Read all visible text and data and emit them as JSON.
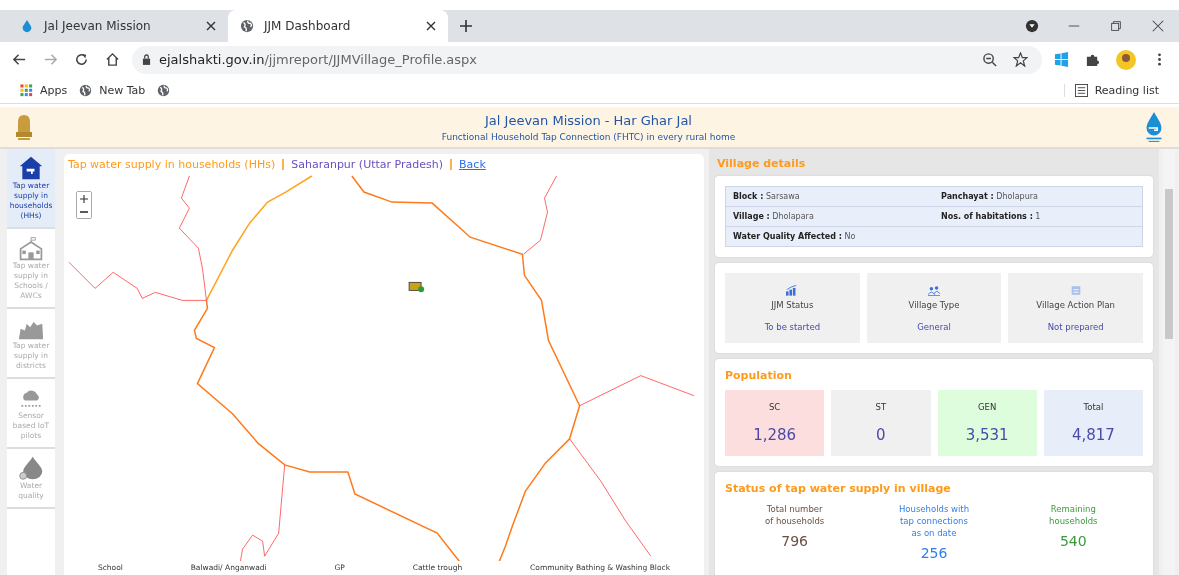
{
  "browser": {
    "tabs": [
      {
        "title": "Jal Jeevan Mission",
        "selected": false
      },
      {
        "title": "JJM Dashboard",
        "selected": true
      }
    ],
    "url_host": "ejalshakti.gov.in",
    "url_path": "/jjmreport/JJMVillage_Profile.aspx",
    "bookmarks": [
      {
        "label": "Apps"
      },
      {
        "label": "New Tab"
      }
    ],
    "reading_list": "Reading list"
  },
  "header": {
    "title": "Jal Jeevan Mission - Har Ghar Jal",
    "subtitle": "Functional Household Tap Connection (FHTC) in every rural home"
  },
  "sidebar": {
    "items": [
      {
        "label": "Tap water supply in households (HHs)",
        "selected": true
      },
      {
        "label": "Tap water supply in Schools / AWCs",
        "selected": false
      },
      {
        "label": "Tap water supply in districts",
        "selected": false
      },
      {
        "label": "Sensor based IoT pilots",
        "selected": false
      },
      {
        "label": "Water quality",
        "selected": false
      }
    ]
  },
  "map": {
    "title": "Tap water supply in households (HHs)",
    "location": "Saharanpur (Uttar Pradesh)",
    "back_link": "Back",
    "legend": [
      "School",
      "Balwadi/ Anganwadi",
      "GP",
      "Cattle trough",
      "Community Bathing & Washing Block"
    ]
  },
  "village_details": {
    "title": "Village details",
    "fields": [
      {
        "label": "Block :",
        "value": "Sarsawa"
      },
      {
        "label": "Panchayat :",
        "value": "Dholapura"
      },
      {
        "label": "Village :",
        "value": "Dholapara"
      },
      {
        "label": "Nos. of habitations :",
        "value": "1"
      },
      {
        "label": "Water Quality Affected :",
        "value": "No"
      }
    ],
    "tiles": [
      {
        "label": "JJM Status",
        "value": "To be started"
      },
      {
        "label": "Village Type",
        "value": "General"
      },
      {
        "label": "Village Action Plan",
        "value": "Not prepared"
      }
    ]
  },
  "population": {
    "title": "Population",
    "groups": [
      {
        "label": "SC",
        "value": "1,286",
        "color": "#fddede"
      },
      {
        "label": "ST",
        "value": "0",
        "color": "#f0f0f0"
      },
      {
        "label": "GEN",
        "value": "3,531",
        "color": "#ddfddc"
      },
      {
        "label": "Total",
        "value": "4,817",
        "color": "#e8eef9"
      }
    ]
  },
  "tap_status": {
    "title": "Status of tap water supply in village",
    "columns": [
      {
        "label": "Total number of households",
        "value": "796"
      },
      {
        "label": "Households with tap connections as on date",
        "value": "256"
      },
      {
        "label": "Remaining households",
        "value": "540"
      }
    ]
  }
}
